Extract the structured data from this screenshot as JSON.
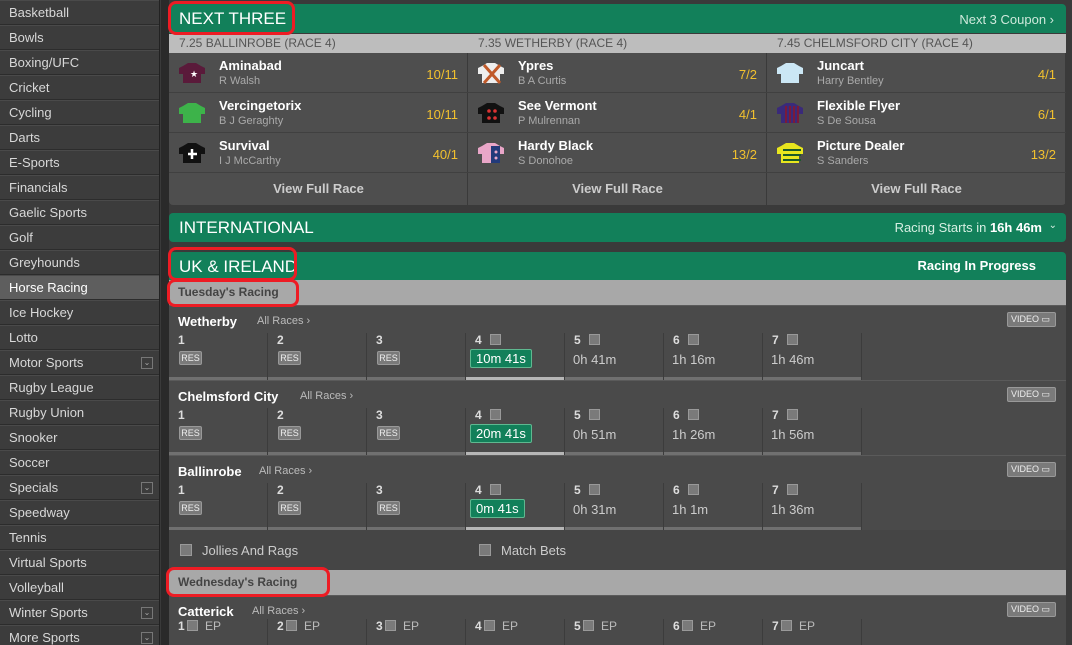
{
  "sidebar": {
    "items": [
      {
        "label": "Basketball"
      },
      {
        "label": "Bowls"
      },
      {
        "label": "Boxing/UFC"
      },
      {
        "label": "Cricket"
      },
      {
        "label": "Cycling"
      },
      {
        "label": "Darts"
      },
      {
        "label": "E-Sports"
      },
      {
        "label": "Financials"
      },
      {
        "label": "Gaelic Sports"
      },
      {
        "label": "Golf"
      },
      {
        "label": "Greyhounds"
      },
      {
        "label": "Horse Racing",
        "active": true
      },
      {
        "label": "Ice Hockey"
      },
      {
        "label": "Lotto"
      },
      {
        "label": "Motor Sports",
        "expand": true
      },
      {
        "label": "Rugby League"
      },
      {
        "label": "Rugby Union"
      },
      {
        "label": "Snooker"
      },
      {
        "label": "Soccer"
      },
      {
        "label": "Specials",
        "expand": true
      },
      {
        "label": "Speedway"
      },
      {
        "label": "Tennis"
      },
      {
        "label": "Virtual Sports"
      },
      {
        "label": "Volleyball"
      },
      {
        "label": "Winter Sports",
        "expand": true
      },
      {
        "label": "More Sports",
        "expand": true
      }
    ]
  },
  "next_three": {
    "title": "NEXT THREE",
    "coupon_link": "Next 3 Coupon ›",
    "view_full_race": "View Full Race",
    "races": [
      {
        "header": "7.25 BALLINROBE (RACE 4)",
        "runners": [
          {
            "name": "Aminabad",
            "jockey": "R Walsh",
            "odds": "10/11",
            "silk": "maroon-star"
          },
          {
            "name": "Vercingetorix",
            "jockey": "B J Geraghty",
            "odds": "10/11",
            "silk": "green"
          },
          {
            "name": "Survival",
            "jockey": "I J McCarthy",
            "odds": "40/1",
            "silk": "black-cross"
          }
        ]
      },
      {
        "header": "7.35 WETHERBY (RACE 4)",
        "runners": [
          {
            "name": "Ypres",
            "jockey": "B A Curtis",
            "odds": "7/2",
            "silk": "white-cross"
          },
          {
            "name": "See Vermont",
            "jockey": "P Mulrennan",
            "odds": "4/1",
            "silk": "black-red-dots"
          },
          {
            "name": "Hardy Black",
            "jockey": "S Donohoe",
            "odds": "13/2",
            "silk": "pink-navy"
          }
        ]
      },
      {
        "header": "7.45 CHELMSFORD CITY (RACE 4)",
        "runners": [
          {
            "name": "Juncart",
            "jockey": "Harry Bentley",
            "odds": "4/1",
            "silk": "light-blue"
          },
          {
            "name": "Flexible Flyer",
            "jockey": "S De Sousa",
            "odds": "6/1",
            "silk": "purple-stripes"
          },
          {
            "name": "Picture Dealer",
            "jockey": "S Sanders",
            "odds": "13/2",
            "silk": "yellow-hoops"
          }
        ]
      }
    ]
  },
  "international": {
    "title": "INTERNATIONAL",
    "starts_label": "Racing Starts in",
    "starts_time": "16h 46m"
  },
  "uk": {
    "title": "UK & IRELAND",
    "status": "Racing In Progress"
  },
  "tuesday": {
    "label": "Tuesday's Racing",
    "meetings": [
      {
        "name": "Wetherby",
        "all": "All Races ›",
        "video": "VIDEO",
        "races": [
          {
            "n": "1",
            "res": "RES"
          },
          {
            "n": "2",
            "res": "RES"
          },
          {
            "n": "3",
            "res": "RES"
          },
          {
            "n": "4",
            "now": "10m 41s"
          },
          {
            "n": "5",
            "time": "0h 41m"
          },
          {
            "n": "6",
            "time": "1h 16m"
          },
          {
            "n": "7",
            "time": "1h 46m"
          }
        ]
      },
      {
        "name": "Chelmsford City",
        "all": "All Races ›",
        "video": "VIDEO",
        "races": [
          {
            "n": "1",
            "res": "RES"
          },
          {
            "n": "2",
            "res": "RES"
          },
          {
            "n": "3",
            "res": "RES"
          },
          {
            "n": "4",
            "now": "20m 41s"
          },
          {
            "n": "5",
            "time": "0h 51m"
          },
          {
            "n": "6",
            "time": "1h 26m"
          },
          {
            "n": "7",
            "time": "1h 56m"
          }
        ]
      },
      {
        "name": "Ballinrobe",
        "all": "All Races ›",
        "video": "VIDEO",
        "races": [
          {
            "n": "1",
            "res": "RES"
          },
          {
            "n": "2",
            "res": "RES"
          },
          {
            "n": "3",
            "res": "RES"
          },
          {
            "n": "4",
            "now": "0m 41s"
          },
          {
            "n": "5",
            "time": "0h 31m"
          },
          {
            "n": "6",
            "time": "1h 1m"
          },
          {
            "n": "7",
            "time": "1h 36m"
          }
        ]
      }
    ],
    "options": [
      "Jollies And Rags",
      "Match Bets"
    ]
  },
  "wednesday": {
    "label": "Wednesday's Racing",
    "meetings": [
      {
        "name": "Catterick",
        "all": "All Races ›",
        "video": "VIDEO",
        "races": [
          {
            "n": "1",
            "ep": "EP"
          },
          {
            "n": "2",
            "ep": "EP"
          },
          {
            "n": "3",
            "ep": "EP"
          },
          {
            "n": "4",
            "ep": "EP"
          },
          {
            "n": "5",
            "ep": "EP"
          },
          {
            "n": "6",
            "ep": "EP"
          },
          {
            "n": "7",
            "ep": "EP"
          }
        ]
      }
    ]
  },
  "colors": {
    "accent": "#12805a",
    "odds": "#f2c12e",
    "highlight": "#ed1c24"
  }
}
